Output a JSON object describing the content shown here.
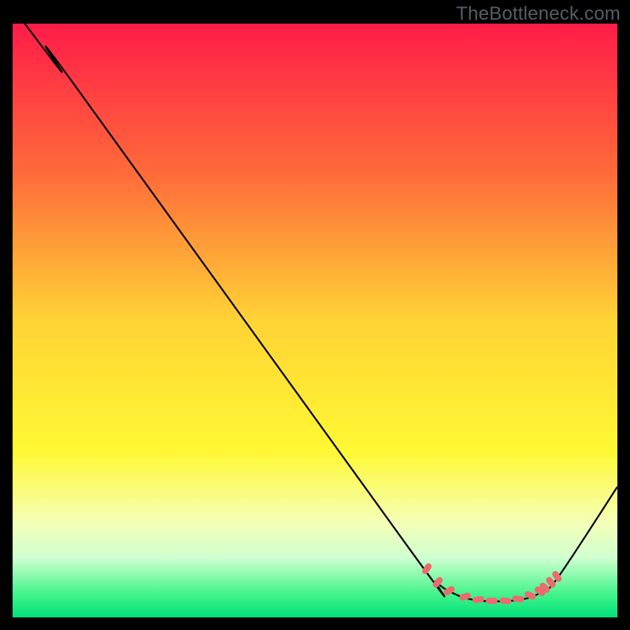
{
  "watermark": "TheBottleneck.com",
  "chart_data": {
    "type": "line",
    "title": "",
    "xlabel": "",
    "ylabel": "",
    "xlim": [
      0,
      100
    ],
    "ylim": [
      0,
      100
    ],
    "gradient_stops": [
      {
        "offset": 0,
        "color": "#ff1c48"
      },
      {
        "offset": 25,
        "color": "#ff6a3a"
      },
      {
        "offset": 50,
        "color": "#ffd335"
      },
      {
        "offset": 72,
        "color": "#fff833"
      },
      {
        "offset": 84,
        "color": "#f4ffb6"
      },
      {
        "offset": 90,
        "color": "#cfffd0"
      },
      {
        "offset": 96,
        "color": "#44f48b"
      },
      {
        "offset": 100,
        "color": "#00e07a"
      }
    ],
    "series": [
      {
        "name": "bottleneck-curve",
        "points": [
          {
            "x": 2,
            "y": 100
          },
          {
            "x": 8,
            "y": 92
          },
          {
            "x": 10,
            "y": 90
          },
          {
            "x": 66,
            "y": 11
          },
          {
            "x": 70,
            "y": 6
          },
          {
            "x": 73,
            "y": 4
          },
          {
            "x": 76,
            "y": 3
          },
          {
            "x": 80,
            "y": 2.7
          },
          {
            "x": 84,
            "y": 3
          },
          {
            "x": 87,
            "y": 4
          },
          {
            "x": 90,
            "y": 6.5
          },
          {
            "x": 100,
            "y": 22
          }
        ]
      }
    ],
    "markers": [
      {
        "x": 68.5,
        "y": 8.2,
        "rot": -55
      },
      {
        "x": 70.3,
        "y": 5.9,
        "rot": -50
      },
      {
        "x": 72.2,
        "y": 4.5,
        "rot": -32
      },
      {
        "x": 74.8,
        "y": 3.5,
        "rot": -18
      },
      {
        "x": 77.0,
        "y": 3.0,
        "rot": -6
      },
      {
        "x": 79.2,
        "y": 2.8,
        "rot": 0
      },
      {
        "x": 81.5,
        "y": 2.8,
        "rot": 5
      },
      {
        "x": 83.6,
        "y": 3.1,
        "rot": 10
      },
      {
        "x": 85.6,
        "y": 3.7,
        "rot": 22
      },
      {
        "x": 87.2,
        "y": 4.4,
        "rot": 35
      },
      {
        "x": 88.0,
        "y": 5.0,
        "rot": 45
      },
      {
        "x": 89.0,
        "y": 5.9,
        "rot": 52
      },
      {
        "x": 90.0,
        "y": 6.9,
        "rot": 56
      }
    ],
    "marker_style": {
      "fill": "#ed6a6f",
      "rx": 4,
      "w": 15,
      "h": 8
    }
  }
}
